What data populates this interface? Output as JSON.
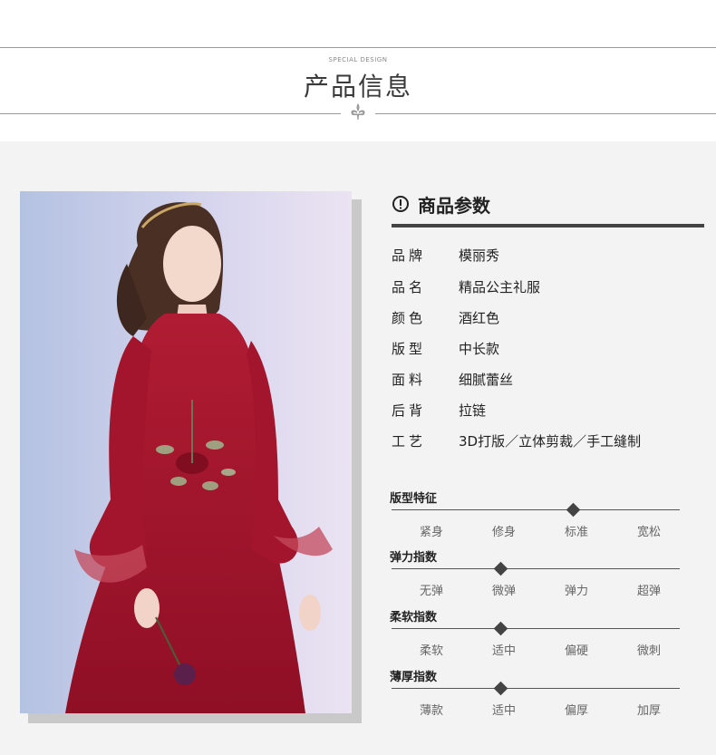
{
  "header": {
    "special_design": "SPECIAL DESIGN",
    "title": "产品信息"
  },
  "params": {
    "title": "商品参数",
    "icon": "exclamation-circle-icon",
    "rows": [
      {
        "key": "品牌",
        "value": "模丽秀"
      },
      {
        "key": "品名",
        "value": "精品公主礼服"
      },
      {
        "key": "颜色",
        "value": "酒红色"
      },
      {
        "key": "版型",
        "value": "中长款"
      },
      {
        "key": "面料",
        "value": "细腻蕾丝"
      },
      {
        "key": "后背",
        "value": "拉链"
      },
      {
        "key": "工艺",
        "value": "3D打版／立体剪裁／手工缝制"
      }
    ]
  },
  "scales": [
    {
      "title": "版型特征",
      "options": [
        "紧身",
        "修身",
        "标准",
        "宽松"
      ],
      "selected_position": 0.63
    },
    {
      "title": "弹力指数",
      "options": [
        "无弹",
        "微弹",
        "弹力",
        "超弹"
      ],
      "selected_position": 0.38
    },
    {
      "title": "柔软指数",
      "options": [
        "柔软",
        "适中",
        "偏硬",
        "微刺"
      ],
      "selected_position": 0.38
    },
    {
      "title": "薄厚指数",
      "options": [
        "薄款",
        "适中",
        "偏厚",
        "加厚"
      ],
      "selected_position": 0.38
    }
  ],
  "colors": {
    "dress": "#a0122a",
    "background_section": "#f3f3f3",
    "accent_bar": "#444444"
  }
}
